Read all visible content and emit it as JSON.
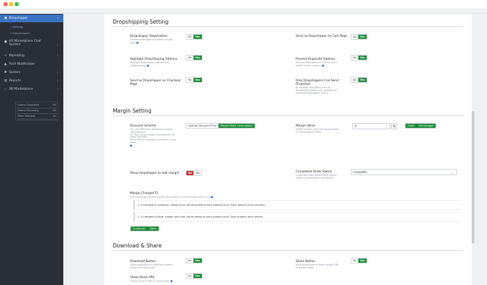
{
  "window": {
    "colors": {
      "close": "#fe5f57",
      "minimize": "#febc2e",
      "zoom": "#28c840"
    }
  },
  "sidebar": {
    "items": [
      {
        "label": "Dropshipper",
        "icon": "cart-icon",
        "active": true
      },
      {
        "label": "HP Marketplace Chat System",
        "icon": "chat-icon"
      },
      {
        "label": "Marketing",
        "icon": "share-icon"
      },
      {
        "label": "Push Notification",
        "icon": "bell-icon"
      },
      {
        "label": "System",
        "icon": "gear-icon"
      },
      {
        "label": "Reports",
        "icon": "bar-chart-icon"
      },
      {
        "label": "XB Marketplace",
        "icon": "line-chart-icon"
      }
    ],
    "subitems": [
      "» Settings",
      "» Dropshippers"
    ],
    "stats": [
      {
        "label": "Orders Completed",
        "value": "0%"
      },
      {
        "label": "Orders Processing",
        "value": "0%"
      },
      {
        "label": "Other Statuses",
        "value": "0%"
      }
    ]
  },
  "dropshipping": {
    "title": "Dropshipping Setting",
    "fields": [
      {
        "label": "Dropshipper Registration",
        "desc": "Enable dropshipper registration on sign page",
        "no": "No",
        "yes": "Yes"
      },
      {
        "label": "Send as Dropshipper on Cart Page",
        "desc": "",
        "no": "No",
        "yes": "Yes"
      },
      {
        "label": "Highlight Dropshipping Address",
        "desc": "Highlight dropshipping address with additional type",
        "no": "No",
        "yes": "Yes"
      },
      {
        "label": "Prevent Duplicate Address",
        "desc": "Prevent dropshipper for creating same profile for the customer",
        "no": "No",
        "yes": "Yes"
      },
      {
        "label": "Send as Dropshipper on Checkout Page",
        "desc": "",
        "no": "No",
        "yes": "Yes"
      },
      {
        "label": "Only Dropshippers Can Send Dropships",
        "desc": "By enabling this option, send as Dropshipper feature only available for registered dropshipper before",
        "no": "No",
        "yes": "Yes"
      }
    ]
  },
  "margin": {
    "title": "Margin Setting",
    "scheme_label": "Discount Scheme",
    "scheme_desc": [
      "You can either give dropshipper special price/discount",
      "Or They can get margin (commission) for every purchase",
      "Which can be charged to customer or your store"
    ],
    "scheme_options": [
      "Special Discount Price",
      "Margin Basic Commission"
    ],
    "value_label": "Margin Value",
    "value_desc": "Default margin value that will be added on dropshipping section",
    "value": "0",
    "value_unit": "%",
    "value_types": [
      "Fixed",
      "Percentage"
    ],
    "edit_label": "Allow dropshipper to edit margin",
    "edit_no": "No",
    "edit_yes": "Yes",
    "status_label": "Completed Order Status",
    "status_desc": "Completed order status where margin added to dropshipper's transaction",
    "status_value": "Complete",
    "charged_label": "Margin Charged To",
    "charged_desc": "This will decide whether margin will be added to each product price or not",
    "charged_notes": [
      "1. If charged to customer, margin price will be added to each product price. Each product price increase.",
      "2. If charged to Store, margin price will not be added to each product price. Each product price remain"
    ],
    "charged_options": [
      "Customer",
      "Store"
    ]
  },
  "download": {
    "title": "Download & Share",
    "fields": [
      {
        "label": "Download Button",
        "desc": "Allow dropshipper to download product image on product page",
        "no": "No",
        "yes": "Yes"
      },
      {
        "label": "Share Button",
        "desc": "Allow dropshipper to share product URL on product page",
        "no": "No",
        "yes": "Yes"
      },
      {
        "label": "Show Share URL",
        "desc": "Include product URL on share button",
        "no": "No",
        "yes": "Yes"
      }
    ]
  }
}
